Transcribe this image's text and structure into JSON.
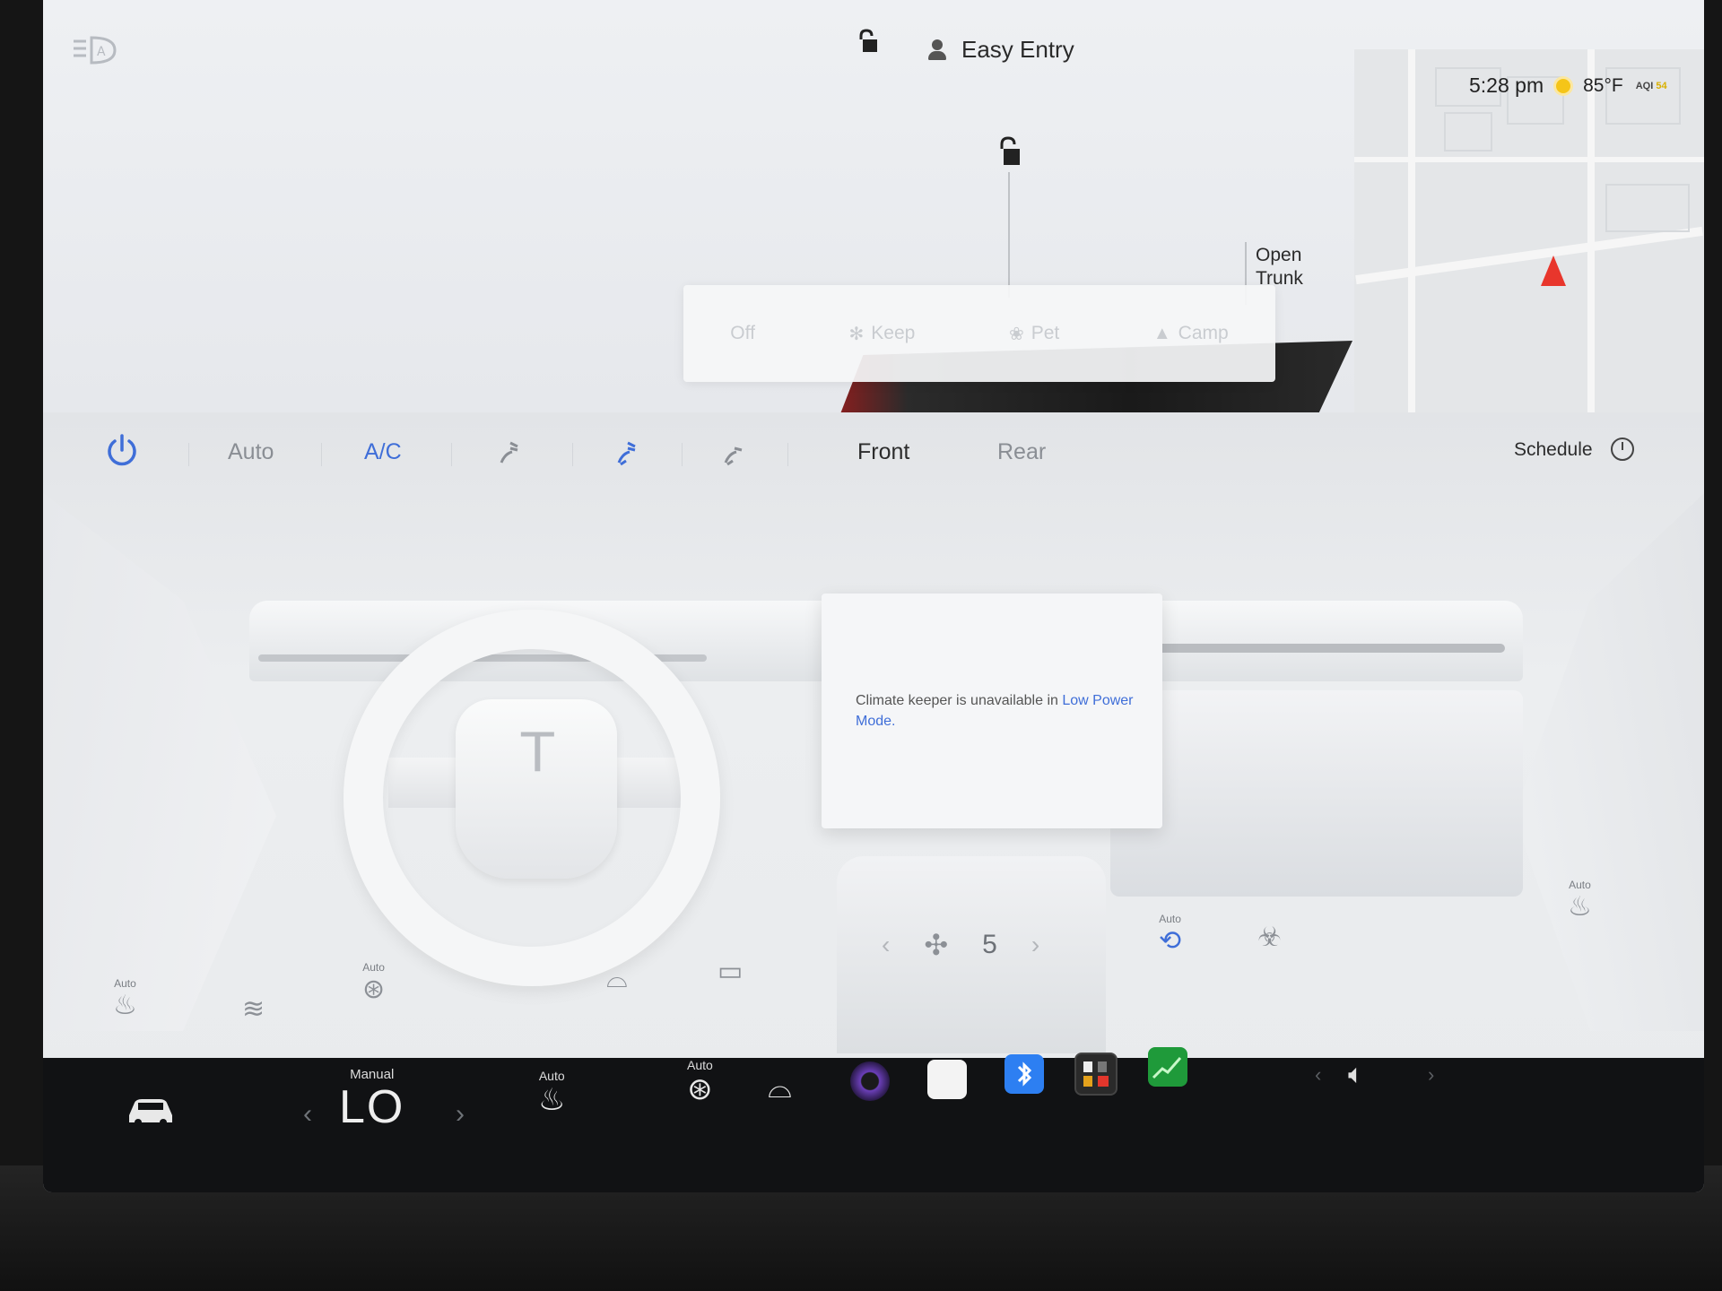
{
  "header": {
    "driver_profile": "Easy Entry",
    "time": "5:28 pm",
    "temperature": "85°F",
    "aqi_label": "AQI",
    "aqi_value": "54"
  },
  "car_view": {
    "open_trunk_line1": "Open",
    "open_trunk_line2": "Trunk"
  },
  "climate_keeper": {
    "options": [
      "Off",
      "Keep",
      "Pet",
      "Camp"
    ]
  },
  "climate_bar": {
    "auto_label": "Auto",
    "ac_label": "A/C",
    "front_label": "Front",
    "rear_label": "Rear",
    "schedule_label": "Schedule"
  },
  "message": {
    "text": "Climate keeper is unavailable in ",
    "link": "Low Power Mode",
    "suffix": "."
  },
  "climate_controls": {
    "seat_left_mode": "Auto",
    "steering_heat_mode": "Auto",
    "fan_speed": "5",
    "recirculate_mode": "Auto",
    "seat_right_mode": "Auto"
  },
  "taskbar": {
    "temp_mode": "Manual",
    "temp_value": "LO",
    "seat_heat_mode": "Auto",
    "steering_heat_mode": "Auto"
  },
  "colors": {
    "accent_blue": "#3f6ed8",
    "nav_arrow": "#e8362c",
    "taskbar_bg": "#111214"
  }
}
